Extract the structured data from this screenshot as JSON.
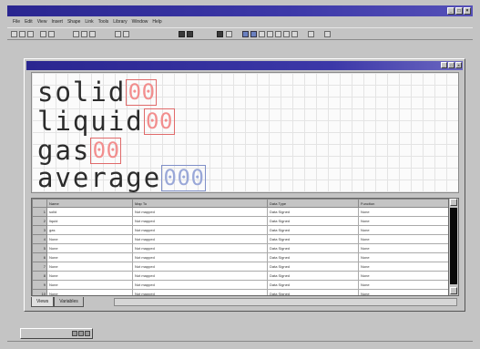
{
  "app": {
    "title": "",
    "menu": [
      "File",
      "Edit",
      "View",
      "Insert",
      "Shape",
      "Link",
      "Tools",
      "Library",
      "Window",
      "Help"
    ]
  },
  "child_window": {
    "title": ""
  },
  "canvas": {
    "words": [
      {
        "label": "solid",
        "digits": [
          "0",
          "0"
        ],
        "color": "#e06a6a"
      },
      {
        "label": "liquid",
        "digits": [
          "0",
          "0"
        ],
        "color": "#e06a6a"
      },
      {
        "label": "gas",
        "digits": [
          "0",
          "0"
        ],
        "color": "#e06a6a"
      },
      {
        "label": "average",
        "digits": [
          "0",
          "0",
          "0"
        ],
        "color": "#8090c8"
      }
    ]
  },
  "grid": {
    "columns": [
      "Name",
      "Map To",
      "Data Type",
      "Function"
    ],
    "rows": [
      {
        "num": "1",
        "name": "solid",
        "map": "Not mapped",
        "type": "Data Signed",
        "fn": "None"
      },
      {
        "num": "2",
        "name": "liquid",
        "map": "Not mapped",
        "type": "Data Signed",
        "fn": "None"
      },
      {
        "num": "3",
        "name": "gas",
        "map": "Not mapped",
        "type": "Data Signed",
        "fn": "None"
      },
      {
        "num": "4",
        "name": "None",
        "map": "Not mapped",
        "type": "Data Signed",
        "fn": "None"
      },
      {
        "num": "5",
        "name": "None",
        "map": "Not mapped",
        "type": "Data Signed",
        "fn": "None"
      },
      {
        "num": "6",
        "name": "None",
        "map": "Not mapped",
        "type": "Data Signed",
        "fn": "None"
      },
      {
        "num": "7",
        "name": "None",
        "map": "Not mapped",
        "type": "Data Signed",
        "fn": "None"
      },
      {
        "num": "8",
        "name": "None",
        "map": "Not mapped",
        "type": "Data Signed",
        "fn": "None"
      },
      {
        "num": "9",
        "name": "None",
        "map": "Not mapped",
        "type": "Data Signed",
        "fn": "None"
      },
      {
        "num": "10",
        "name": "None",
        "map": "Not mapped",
        "type": "Data Signed",
        "fn": "None"
      }
    ]
  },
  "tabs": [
    "Views",
    "Variables"
  ],
  "taskbar": {
    "label": ""
  },
  "colors": {
    "titlebar": "#2a2690",
    "digit_box_red": "#e06a6a",
    "digit_box_blue": "#8090c8"
  }
}
